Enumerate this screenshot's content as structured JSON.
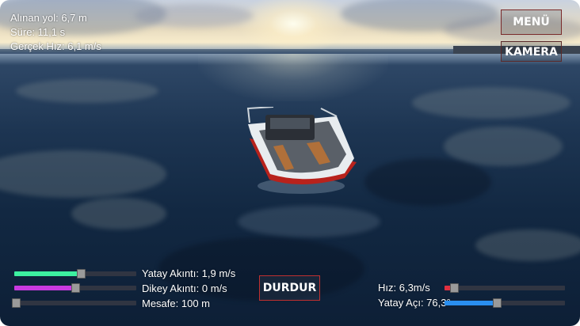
{
  "stats": {
    "distance": "Alınan yol: 6,7 m",
    "time": "Süre: 11,1 s",
    "real_speed": "Gerçek Hız: 6,1 m/s"
  },
  "buttons": {
    "menu": "MENÜ",
    "camera": "KAMERA",
    "stop": "DURDUR"
  },
  "left_controls": [
    {
      "label": "Yatay Akıntı: 1,9 m/s",
      "value_fraction": 0.55,
      "fill_color": "#3df0a0"
    },
    {
      "label": "Dikey Akıntı: 0 m/s",
      "value_fraction": 0.5,
      "fill_color": "#c93ae0"
    },
    {
      "label": "Mesafe: 100 m",
      "value_fraction": 0.0,
      "fill_color": ""
    }
  ],
  "right_controls": [
    {
      "label": "Hız: 6,3m/s",
      "value_fraction": 0.05,
      "fill_color": "#e03040"
    },
    {
      "label": "Yatay Açı: 76,3°",
      "value_fraction": 0.43,
      "fill_color": "#2a8ff0"
    }
  ],
  "colors": {
    "button_border": "#c03030",
    "water": "#122842"
  }
}
